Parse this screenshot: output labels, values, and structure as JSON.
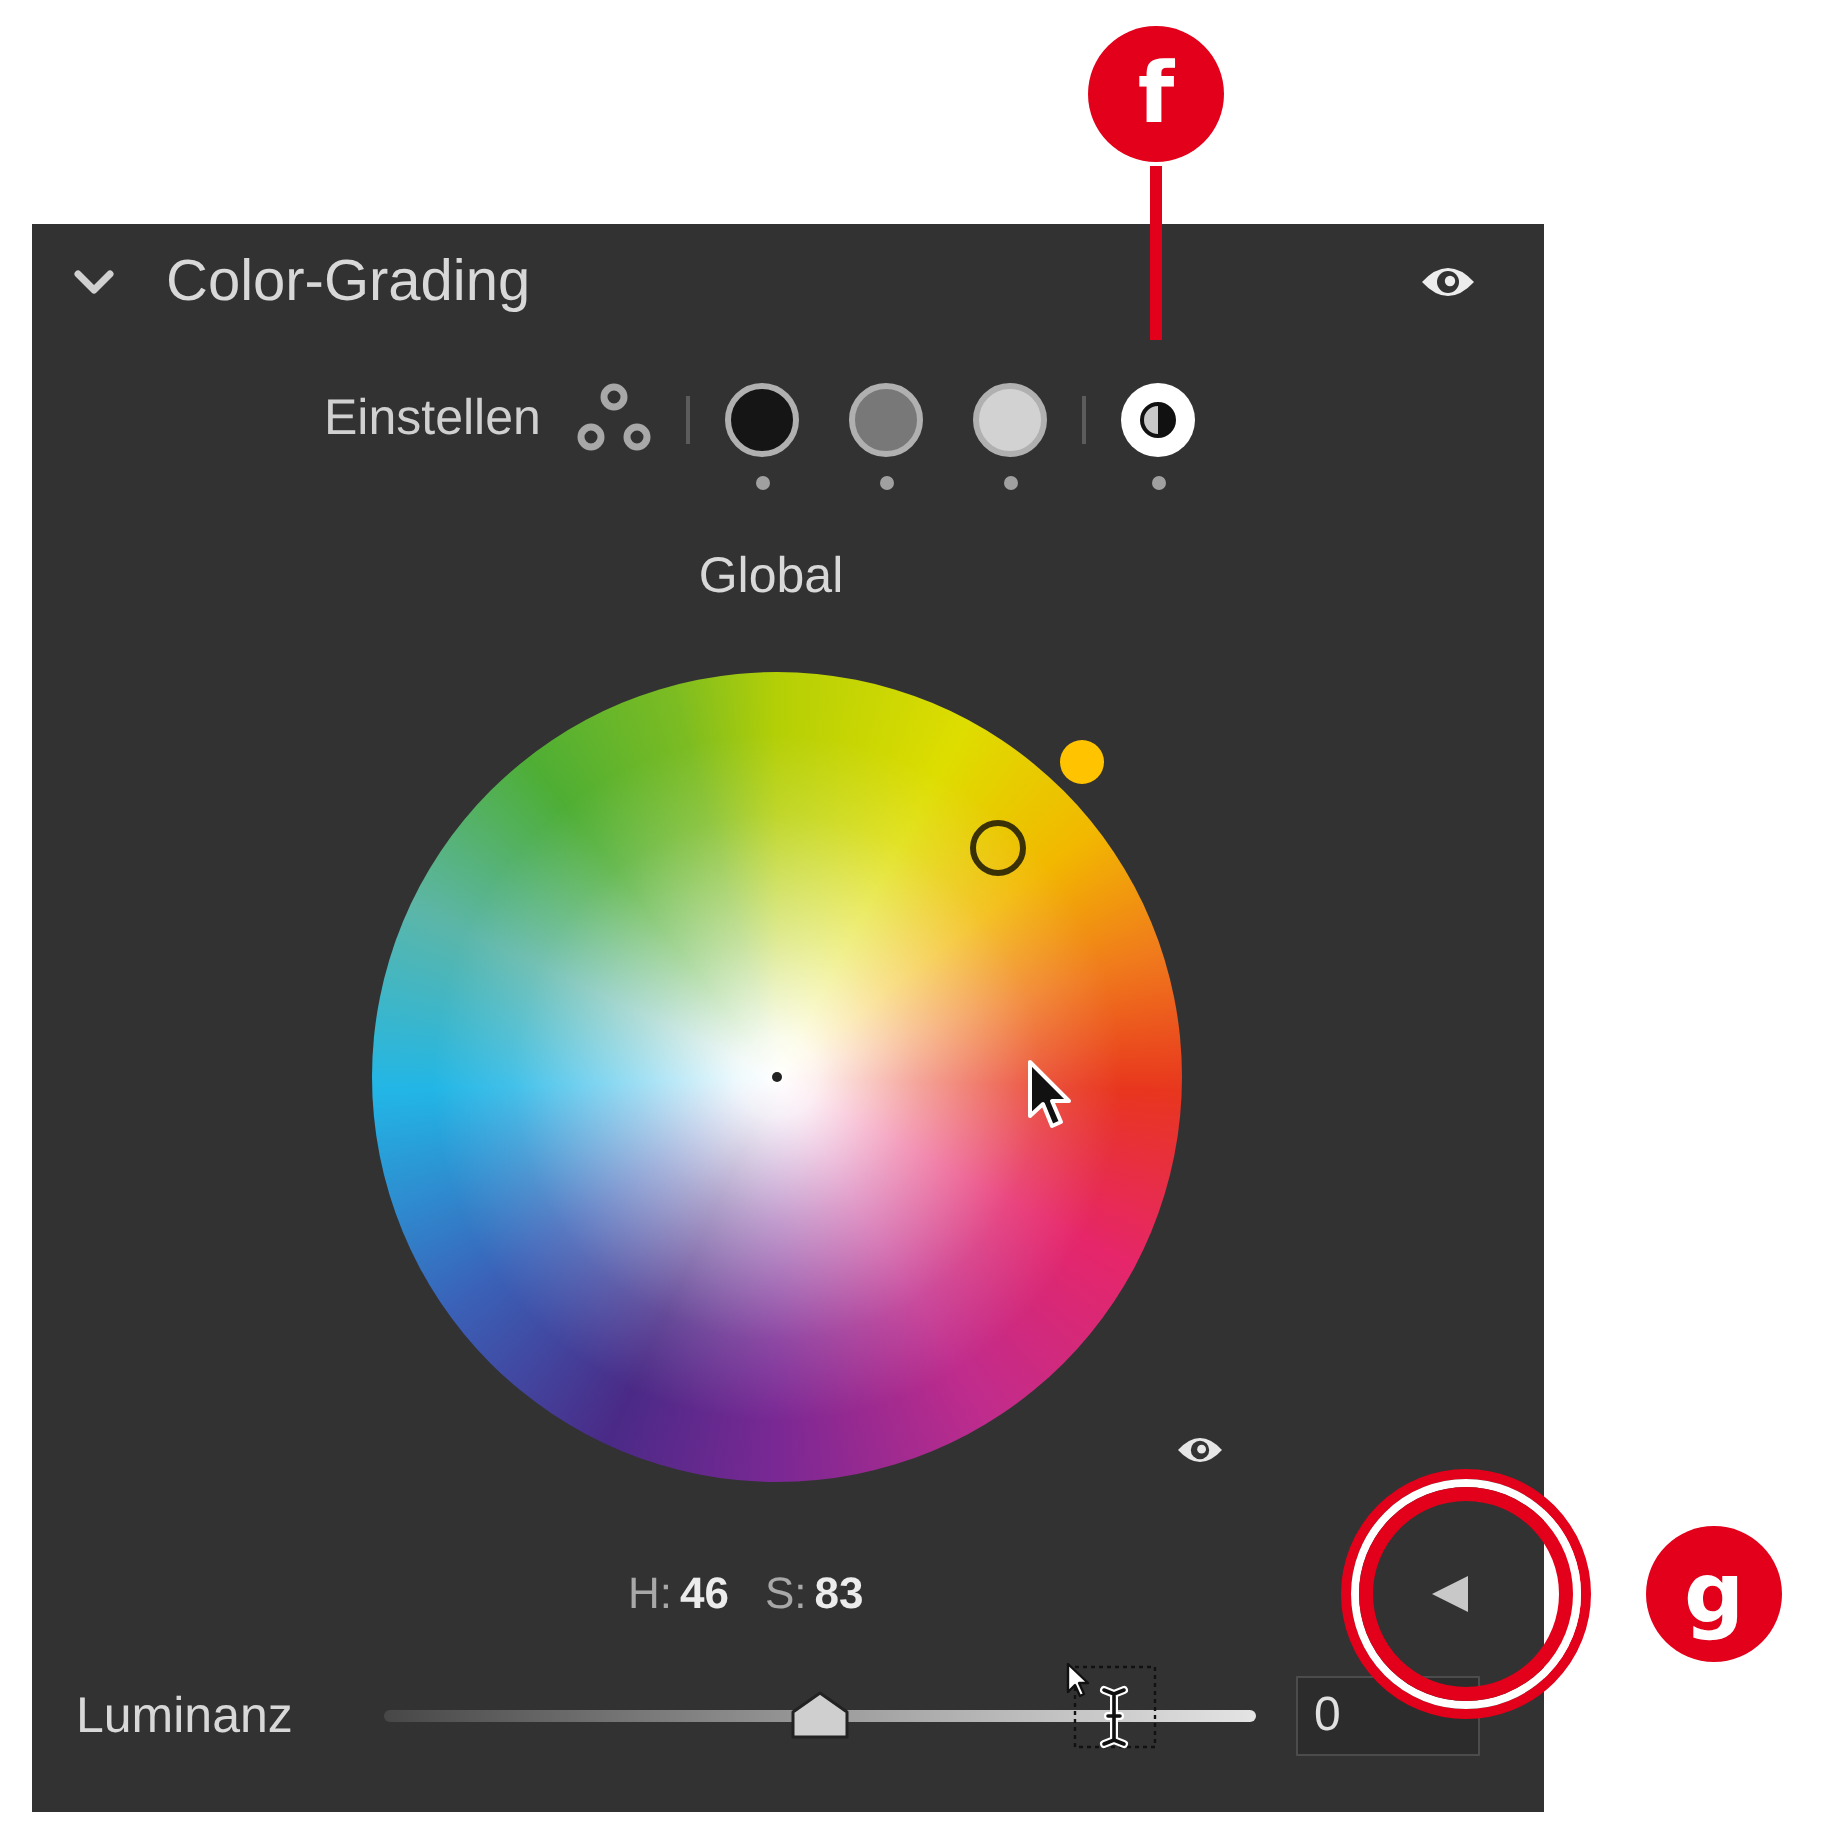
{
  "callouts": [
    {
      "label": "f"
    },
    {
      "label": "g"
    }
  ],
  "panel": {
    "title": "Color-Grading",
    "expanded": true
  },
  "modes": {
    "label": "Einstellen",
    "items": [
      {
        "kind": "three-way",
        "selected": false
      },
      {
        "kind": "shadows",
        "selected": false
      },
      {
        "kind": "midtones",
        "selected": false
      },
      {
        "kind": "highlights",
        "selected": false
      },
      {
        "kind": "global",
        "selected": true
      }
    ]
  },
  "wheel": {
    "title": "Global",
    "hue_label": "H:",
    "hue_value": "46",
    "saturation_label": "S:",
    "saturation_value": "83"
  },
  "luminance": {
    "label": "Luminanz",
    "level": 0.5,
    "value": "0"
  }
}
